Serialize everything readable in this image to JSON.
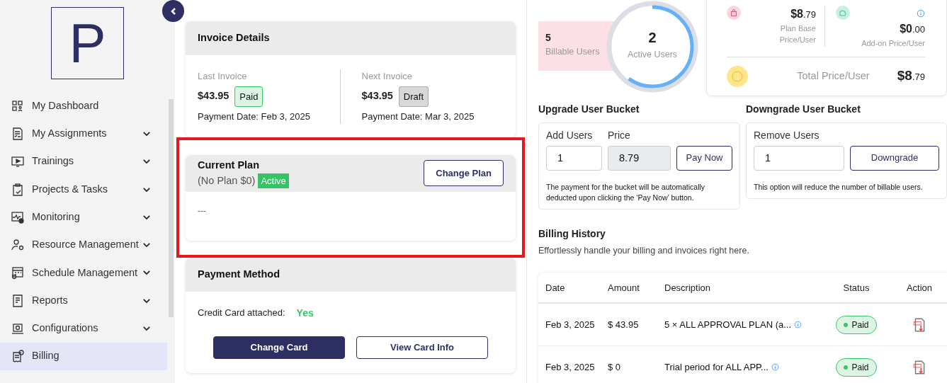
{
  "sidebar": {
    "logo_letter": "P",
    "items": [
      {
        "label": "My Dashboard",
        "expandable": false,
        "selected": false
      },
      {
        "label": "My Assignments",
        "expandable": true,
        "selected": false
      },
      {
        "label": "Trainings",
        "expandable": true,
        "selected": false
      },
      {
        "label": "Projects & Tasks",
        "expandable": true,
        "selected": false
      },
      {
        "label": "Monitoring",
        "expandable": true,
        "selected": false
      },
      {
        "label": "Resource Management",
        "expandable": true,
        "selected": false
      },
      {
        "label": "Schedule Management",
        "expandable": true,
        "selected": false
      },
      {
        "label": "Reports",
        "expandable": true,
        "selected": false
      },
      {
        "label": "Configurations",
        "expandable": true,
        "selected": false
      },
      {
        "label": "Billing",
        "expandable": false,
        "selected": true
      }
    ]
  },
  "invoice_details": {
    "title": "Invoice Details",
    "invoices": [
      {
        "label": "Last Invoice",
        "amount": "$43.95",
        "status": "Paid",
        "kind": "paid",
        "payment_date": "Payment Date: Feb 3, 2025"
      },
      {
        "label": "Next Invoice",
        "amount": "$43.95",
        "status": "Draft",
        "kind": "draft",
        "payment_date": "Payment Date: Mar 3, 2025"
      }
    ]
  },
  "current_plan": {
    "title": "Current Plan",
    "subtitle": "(No Plan $0)",
    "status": "Active",
    "button": "Change Plan",
    "body": "---",
    "highlighted": true
  },
  "payment_method": {
    "title": "Payment Method",
    "label": "Credit Card attached:",
    "value": "Yes",
    "buttons": [
      {
        "label": "Change Card",
        "kind": "primary"
      },
      {
        "label": "View Card Info",
        "kind": "outline"
      }
    ]
  },
  "users": {
    "billable_count": "5",
    "billable_label": "Billable Users",
    "active_count": "2",
    "active_label": "Active Users",
    "level": 0.6
  },
  "pricing": {
    "plan_base": {
      "main": "$8",
      "cents": ".79",
      "label": "Plan Base Price/User"
    },
    "addon": {
      "main": "$0",
      "cents": ".00",
      "label": "Add-on Price/User"
    },
    "total": {
      "label": "Total Price/User",
      "main": "$8",
      "cents": ".79"
    }
  },
  "upgrade": {
    "title": "Upgrade User Bucket",
    "add_label": "Add Users",
    "add_value": "1",
    "price_label": "Price",
    "price_value": "8.79",
    "button": "Pay Now",
    "note": "The payment for the bucket will be automatically deducted upon clicking the ‘Pay Now’ button."
  },
  "downgrade": {
    "title": "Downgrade User Bucket",
    "remove_label": "Remove Users",
    "remove_value": "1",
    "button": "Downgrade",
    "note": "This option will reduce the number of billable users."
  },
  "billing_history": {
    "title": "Billing History",
    "subtitle": "Effortlessly handle your billing and invoices right here.",
    "columns": [
      "Date",
      "Amount",
      "Description",
      "Status",
      "Action"
    ],
    "rows": [
      {
        "date": "Feb 3, 2025",
        "amount": "$ 43.95",
        "description": "5 × ALL APPROVAL PLAN (a...",
        "status": "Paid"
      },
      {
        "date": "Feb 3, 2025",
        "amount": "$ 0",
        "description": "Trial period for ALL APP...",
        "status": "Paid"
      }
    ]
  }
}
